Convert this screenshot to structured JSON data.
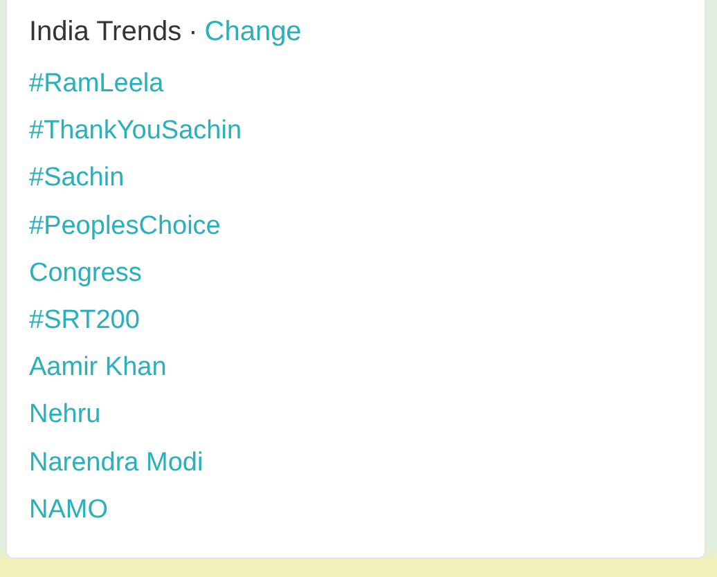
{
  "panel": {
    "title": "India Trends",
    "separator": "·",
    "action": "Change"
  },
  "trends": [
    {
      "label": "#RamLeela"
    },
    {
      "label": "#ThankYouSachin"
    },
    {
      "label": "#Sachin"
    },
    {
      "label": "#PeoplesChoice"
    },
    {
      "label": "Congress"
    },
    {
      "label": "#SRT200"
    },
    {
      "label": "Aamir Khan"
    },
    {
      "label": "Nehru"
    },
    {
      "label": "Narendra Modi"
    },
    {
      "label": "NAMO"
    }
  ]
}
